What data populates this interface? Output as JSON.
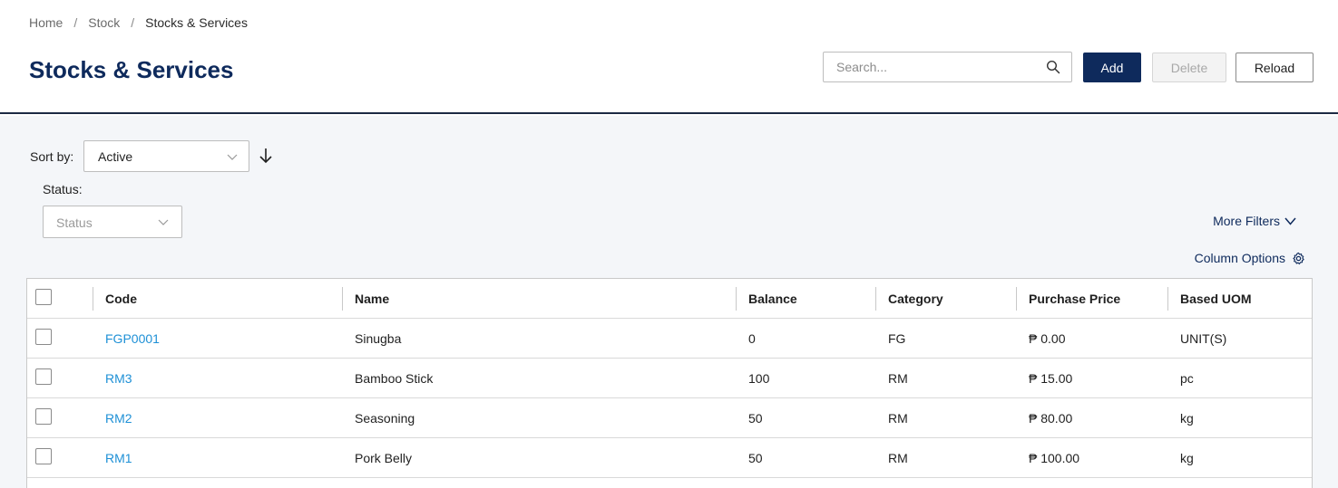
{
  "breadcrumb": {
    "items": [
      "Home",
      "Stock",
      "Stocks & Services"
    ],
    "separator": "/"
  },
  "page": {
    "title": "Stocks & Services"
  },
  "search": {
    "placeholder": "Search...",
    "value": ""
  },
  "toolbar": {
    "add_label": "Add",
    "delete_label": "Delete",
    "reload_label": "Reload"
  },
  "sort": {
    "label": "Sort by:",
    "value": "Active",
    "direction": "descending"
  },
  "status_filter": {
    "label": "Status:",
    "placeholder": "Status"
  },
  "filters": {
    "more_filters_label": "More Filters",
    "column_options_label": "Column Options"
  },
  "table": {
    "headers": {
      "code": "Code",
      "name": "Name",
      "balance": "Balance",
      "category": "Category",
      "purchase_price": "Purchase Price",
      "based_uom": "Based UOM"
    },
    "rows": [
      {
        "code": "FGP0001",
        "name": "Sinugba",
        "balance": "0",
        "category": "FG",
        "purchase_price": "₱ 0.00",
        "based_uom": "UNIT(S)"
      },
      {
        "code": "RM3",
        "name": "Bamboo Stick",
        "balance": "100",
        "category": "RM",
        "purchase_price": "₱ 15.00",
        "based_uom": "pc"
      },
      {
        "code": "RM2",
        "name": "Seasoning",
        "balance": "50",
        "category": "RM",
        "purchase_price": "₱ 80.00",
        "based_uom": "kg"
      },
      {
        "code": "RM1",
        "name": "Pork Belly",
        "balance": "50",
        "category": "RM",
        "purchase_price": "₱ 100.00",
        "based_uom": "kg"
      }
    ]
  },
  "colors": {
    "brand_navy": "#0e2a5c",
    "link_blue": "#1e90d6",
    "content_bg": "#f4f6f9"
  },
  "icons": {
    "search": "search-icon",
    "sort_direction": "arrow-down-icon",
    "dropdown": "chevron-down-icon",
    "column_options": "gear-icon"
  }
}
